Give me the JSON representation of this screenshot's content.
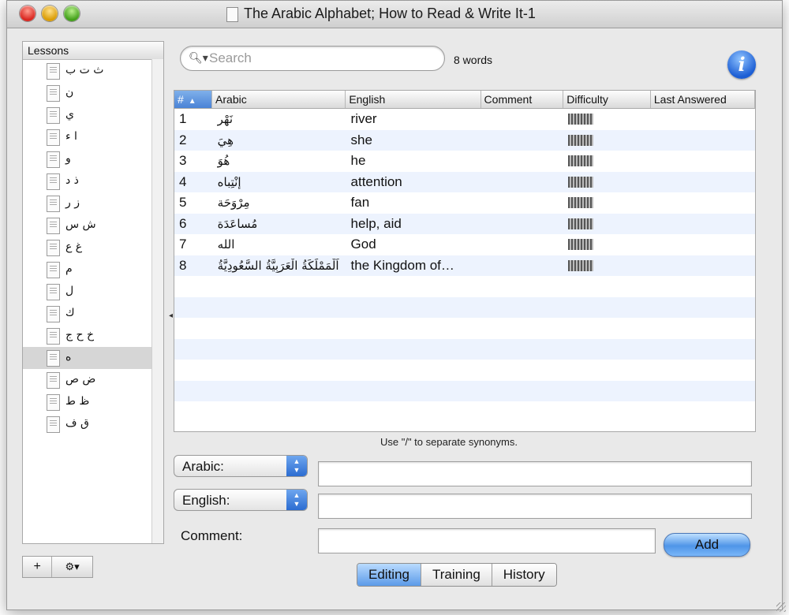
{
  "window": {
    "title": "The Arabic Alphabet; How to Read & Write It-1"
  },
  "sidebar": {
    "header": "Lessons",
    "items": [
      {
        "label": "ث ت ب",
        "selected": false
      },
      {
        "label": "ن",
        "selected": false
      },
      {
        "label": "ي",
        "selected": false
      },
      {
        "label": "ا ء",
        "selected": false
      },
      {
        "label": "و",
        "selected": false
      },
      {
        "label": "ذ د",
        "selected": false
      },
      {
        "label": "ز ر",
        "selected": false
      },
      {
        "label": "ش س",
        "selected": false
      },
      {
        "label": "غ ع",
        "selected": false
      },
      {
        "label": "م",
        "selected": false
      },
      {
        "label": "ل",
        "selected": false
      },
      {
        "label": "ك",
        "selected": false
      },
      {
        "label": "خ ح ج",
        "selected": false
      },
      {
        "label": "ه",
        "selected": true
      },
      {
        "label": "ض ص",
        "selected": false
      },
      {
        "label": "ظ ط",
        "selected": false
      },
      {
        "label": "ق ف",
        "selected": false
      }
    ],
    "tools": {
      "add_label": "+",
      "gear_label": "⚙▾"
    }
  },
  "search": {
    "placeholder": "Search",
    "value": ""
  },
  "word_count": "8 words",
  "table": {
    "columns": {
      "num": "#",
      "arabic": "Arabic",
      "english": "English",
      "comment": "Comment",
      "difficulty": "Difficulty",
      "last": "Last Answered"
    },
    "rows": [
      {
        "num": "1",
        "arabic": "نَهْر",
        "english": "river",
        "comment": "",
        "last": ""
      },
      {
        "num": "2",
        "arabic": "هِيَ",
        "english": "she",
        "comment": "",
        "last": ""
      },
      {
        "num": "3",
        "arabic": "هُوَ",
        "english": "he",
        "comment": "",
        "last": ""
      },
      {
        "num": "4",
        "arabic": "إِنْتِباه",
        "english": "attention",
        "comment": "",
        "last": ""
      },
      {
        "num": "5",
        "arabic": "مِرْوَحَة",
        "english": "fan",
        "comment": "",
        "last": ""
      },
      {
        "num": "6",
        "arabic": "مُساعَدَة",
        "english": "help, aid",
        "comment": "",
        "last": ""
      },
      {
        "num": "7",
        "arabic": "الله",
        "english": "God",
        "comment": "",
        "last": ""
      },
      {
        "num": "8",
        "arabic": "اَلْمَمْلَكَةُ الْعَرَبِيَّةُ السَّعُودِيَّةُ",
        "english": "the Kingdom of…",
        "comment": "",
        "last": ""
      }
    ]
  },
  "hint": "Use \"/\" to separate synonyms.",
  "form": {
    "arabic_popup": "Arabic:",
    "english_popup": "English:",
    "arabic_value": "",
    "english_value": "",
    "comment_label": "Comment:",
    "comment_value": "",
    "add_label": "Add"
  },
  "tabs": [
    {
      "label": "Editing",
      "active": true
    },
    {
      "label": "Training",
      "active": false
    },
    {
      "label": "History",
      "active": false
    }
  ]
}
